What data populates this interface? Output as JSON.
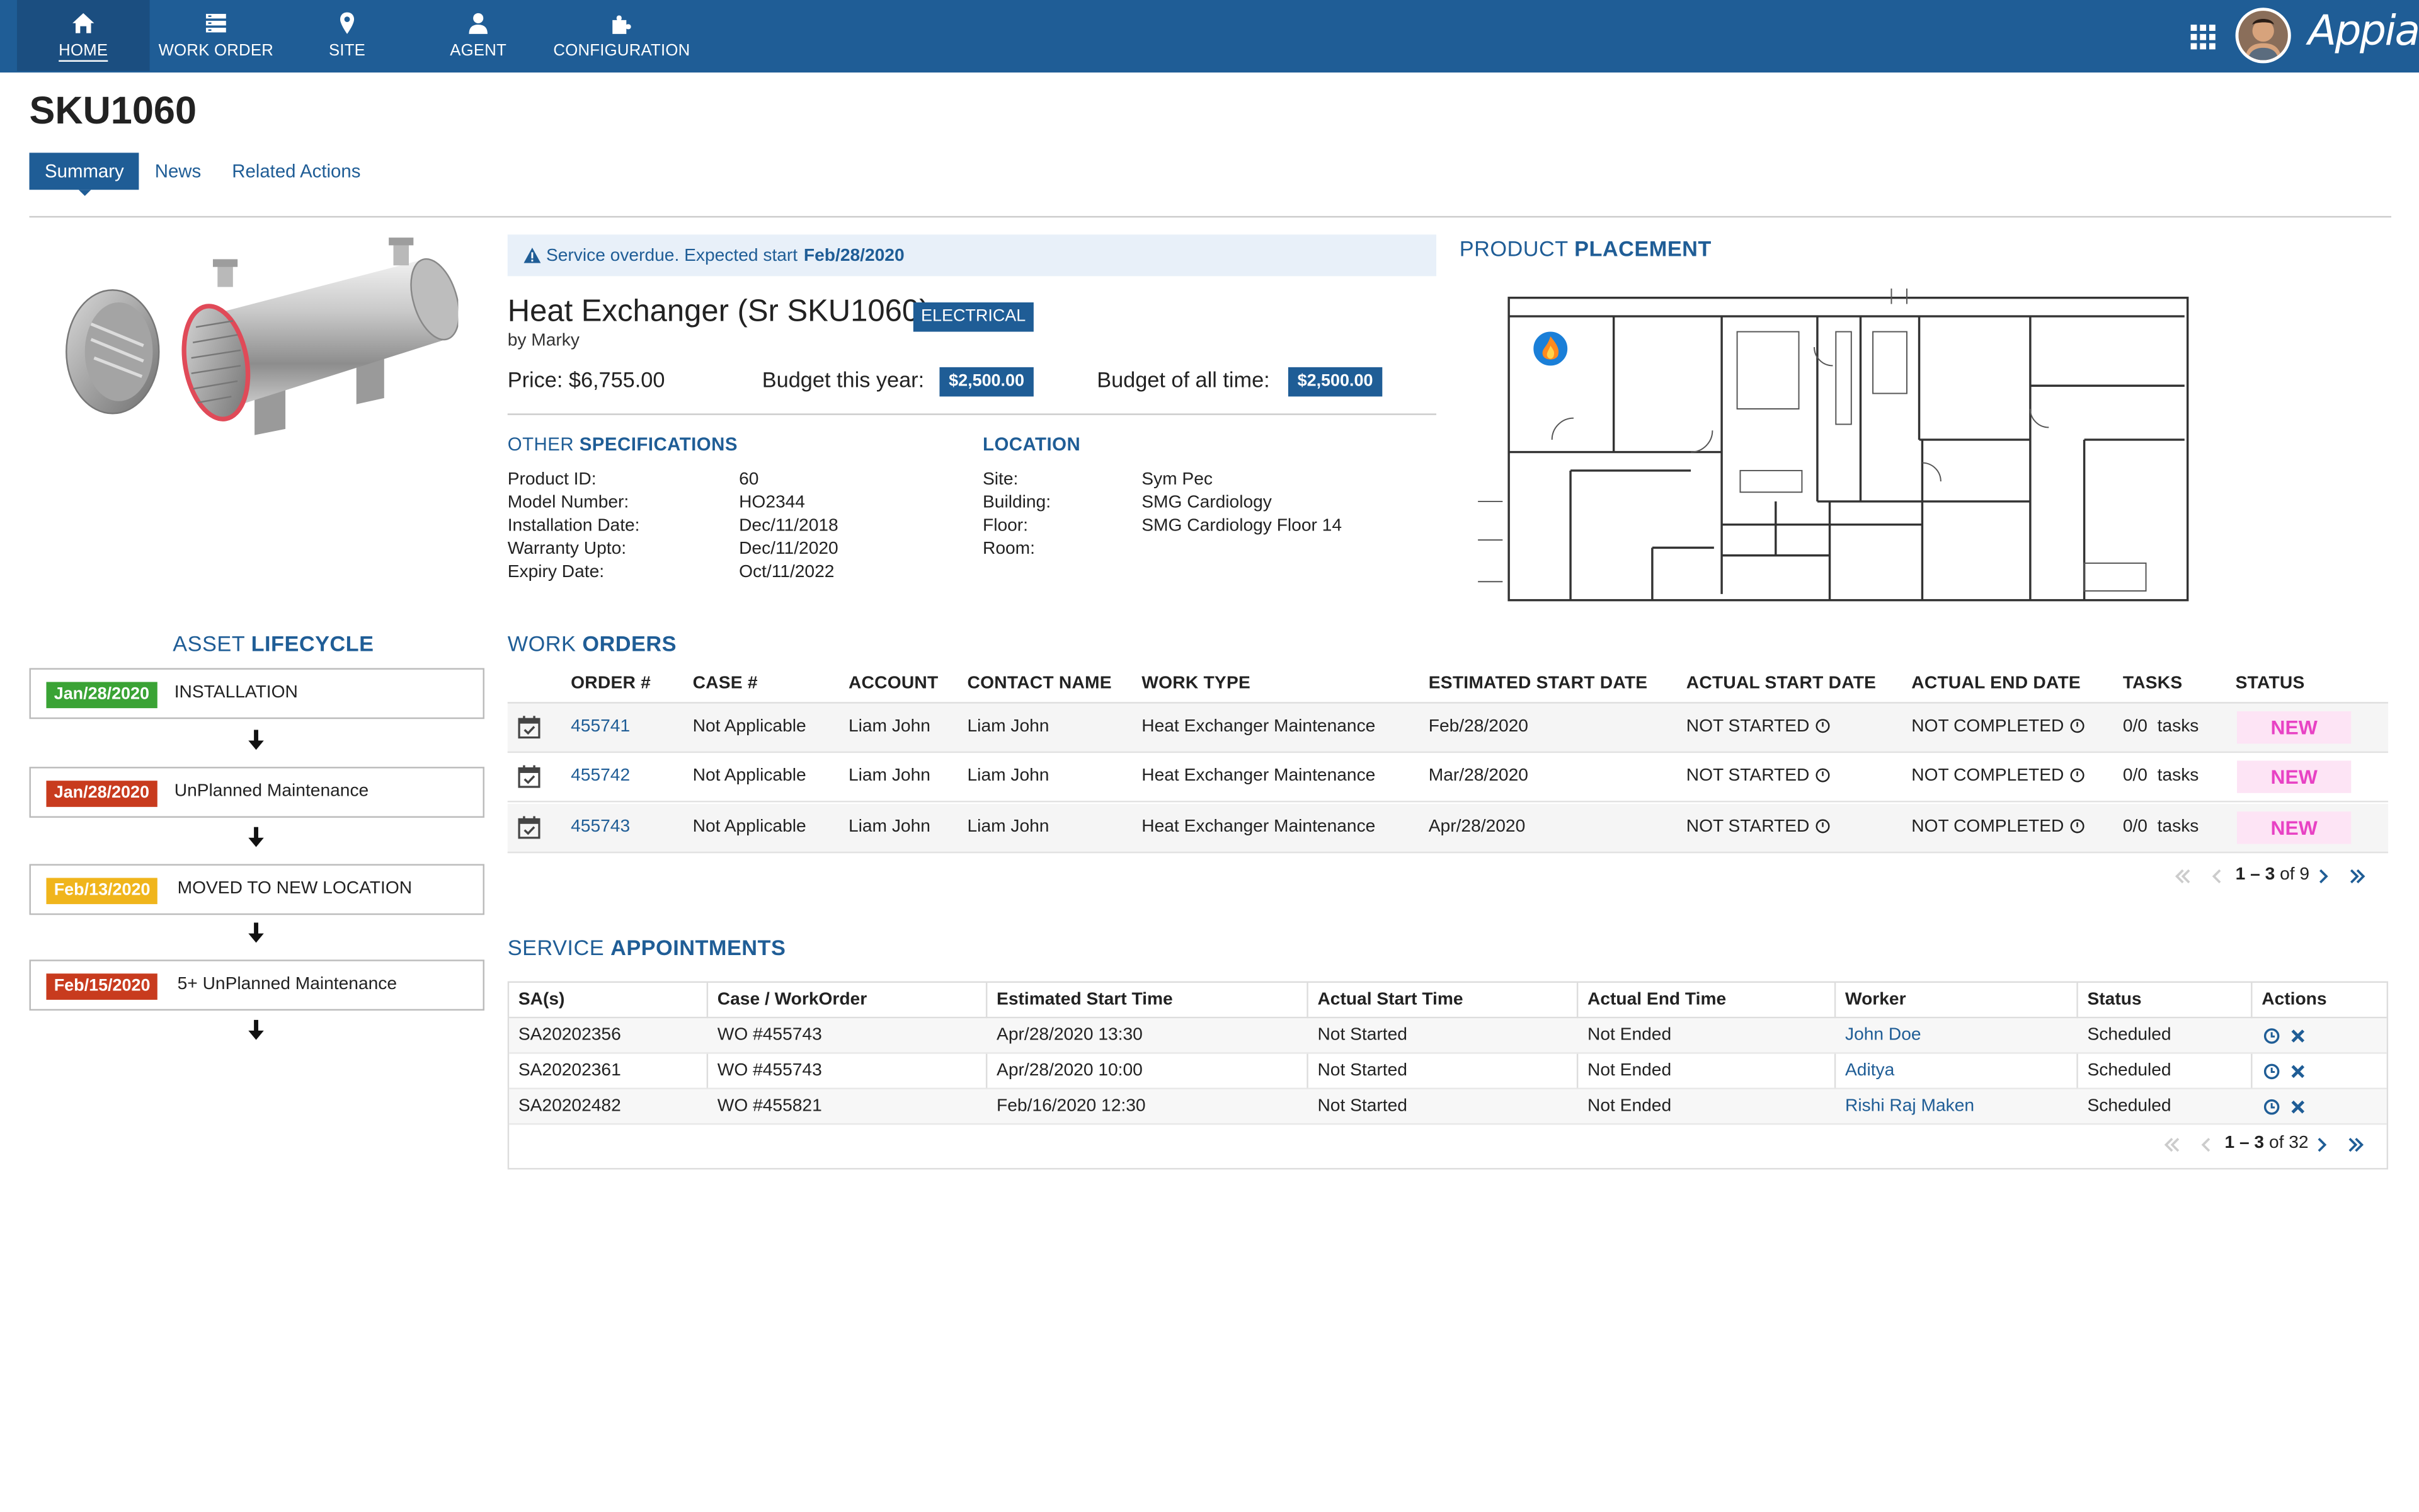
{
  "nav": {
    "items": [
      {
        "label": "HOME",
        "icon": "home-icon"
      },
      {
        "label": "WORK ORDER",
        "icon": "list-icon"
      },
      {
        "label": "SITE",
        "icon": "map-pin-icon"
      },
      {
        "label": "AGENT",
        "icon": "user-icon"
      },
      {
        "label": "CONFIGURATION",
        "icon": "puzzle-icon"
      }
    ],
    "brand": "Appian"
  },
  "page": {
    "title": "SKU1060",
    "tabs": [
      "Summary",
      "News",
      "Related Actions"
    ]
  },
  "banner": {
    "text": "Service overdue. Expected start",
    "date": "Feb/28/2020"
  },
  "product": {
    "name": "Heat Exchanger (Sr SKU1060)",
    "category": "ELECTRICAL",
    "by": "by Marky",
    "price": "Price: $6,755.00",
    "budget_year_label": "Budget this year:",
    "budget_year": "$2,500.00",
    "budget_all_label": "Budget of all time:",
    "budget_all": "$2,500.00"
  },
  "specs": {
    "title_light": "OTHER",
    "title_bold": "SPECIFICATIONS",
    "rows": [
      {
        "label": "Product ID:",
        "value": "60"
      },
      {
        "label": "Model Number:",
        "value": "HO2344"
      },
      {
        "label": "Installation Date:",
        "value": "Dec/11/2018"
      },
      {
        "label": "Warranty Upto:",
        "value": "Dec/11/2020"
      },
      {
        "label": "Expiry Date:",
        "value": "Oct/11/2022"
      }
    ]
  },
  "location": {
    "title": "LOCATION",
    "rows": [
      {
        "label": "Site:",
        "value": "Sym Pec"
      },
      {
        "label": "Building:",
        "value": "SMG Cardiology"
      },
      {
        "label": "Floor:",
        "value": "SMG Cardiology Floor 14"
      },
      {
        "label": "Room:",
        "value": ""
      }
    ]
  },
  "placement": {
    "title_light": "PRODUCT",
    "title_bold": "PLACEMENT"
  },
  "lifecycle": {
    "title_light": "ASSET",
    "title_bold": "LIFECYCLE",
    "events": [
      {
        "date": "Jan/28/2020",
        "text": "INSTALLATION",
        "color": "#3aa335"
      },
      {
        "date": "Jan/28/2020",
        "text": "UnPlanned Maintenance",
        "color": "#c83b1e"
      },
      {
        "date": "Feb/13/2020",
        "text": "MOVED TO NEW LOCATION",
        "color": "#f0b51c"
      },
      {
        "date": "Feb/15/2020",
        "text": "5+ UnPlanned Maintenance",
        "color": "#c83b1e"
      }
    ]
  },
  "work_orders": {
    "title_light": "WORK",
    "title_bold": "ORDERS",
    "columns": [
      "ORDER #",
      "CASE #",
      "ACCOUNT",
      "CONTACT NAME",
      "WORK TYPE",
      "ESTIMATED START DATE",
      "ACTUAL START DATE",
      "ACTUAL END DATE",
      "TASKS",
      "STATUS"
    ],
    "rows": [
      {
        "order": "455741",
        "case": "Not Applicable",
        "account": "Liam John",
        "contact": "Liam John",
        "type": "Heat Exchanger Maintenance",
        "est": "Feb/28/2020",
        "start": "NOT STARTED",
        "end": "NOT COMPLETED",
        "tasks": "0/0  tasks",
        "status": "NEW"
      },
      {
        "order": "455742",
        "case": "Not Applicable",
        "account": "Liam John",
        "contact": "Liam John",
        "type": "Heat Exchanger Maintenance",
        "est": "Mar/28/2020",
        "start": "NOT STARTED",
        "end": "NOT COMPLETED",
        "tasks": "0/0  tasks",
        "status": "NEW"
      },
      {
        "order": "455743",
        "case": "Not Applicable",
        "account": "Liam John",
        "contact": "Liam John",
        "type": "Heat Exchanger Maintenance",
        "est": "Apr/28/2020",
        "start": "NOT STARTED",
        "end": "NOT COMPLETED",
        "tasks": "0/0  tasks",
        "status": "NEW"
      }
    ],
    "pager": {
      "range": "1 – 3",
      "of": "of 9"
    }
  },
  "appointments": {
    "title_light": "SERVICE",
    "title_bold": "APPOINTMENTS",
    "columns": [
      "SA(s)",
      "Case / WorkOrder",
      "Estimated Start Time",
      "Actual Start Time",
      "Actual End Time",
      "Worker",
      "Status",
      "Actions"
    ],
    "rows": [
      {
        "sa": "SA20202356",
        "wo": "WO #455743",
        "est": "Apr/28/2020 13:30",
        "start": "Not Started",
        "end": "Not Ended",
        "worker": "John Doe",
        "status": "Scheduled"
      },
      {
        "sa": "SA20202361",
        "wo": "WO #455743",
        "est": "Apr/28/2020 10:00",
        "start": "Not Started",
        "end": "Not Ended",
        "worker": "Aditya",
        "status": "Scheduled"
      },
      {
        "sa": "SA20202482",
        "wo": "WO #455821",
        "est": "Feb/16/2020 12:30",
        "start": "Not Started",
        "end": "Not Ended",
        "worker": "Rishi Raj Maken",
        "status": "Scheduled"
      }
    ],
    "pager": {
      "range": "1 – 3",
      "of": "of 32"
    }
  },
  "colors": {
    "primary": "#1f5d96",
    "status_new_bg": "#fde4f5",
    "status_new_text": "#e842c4"
  }
}
